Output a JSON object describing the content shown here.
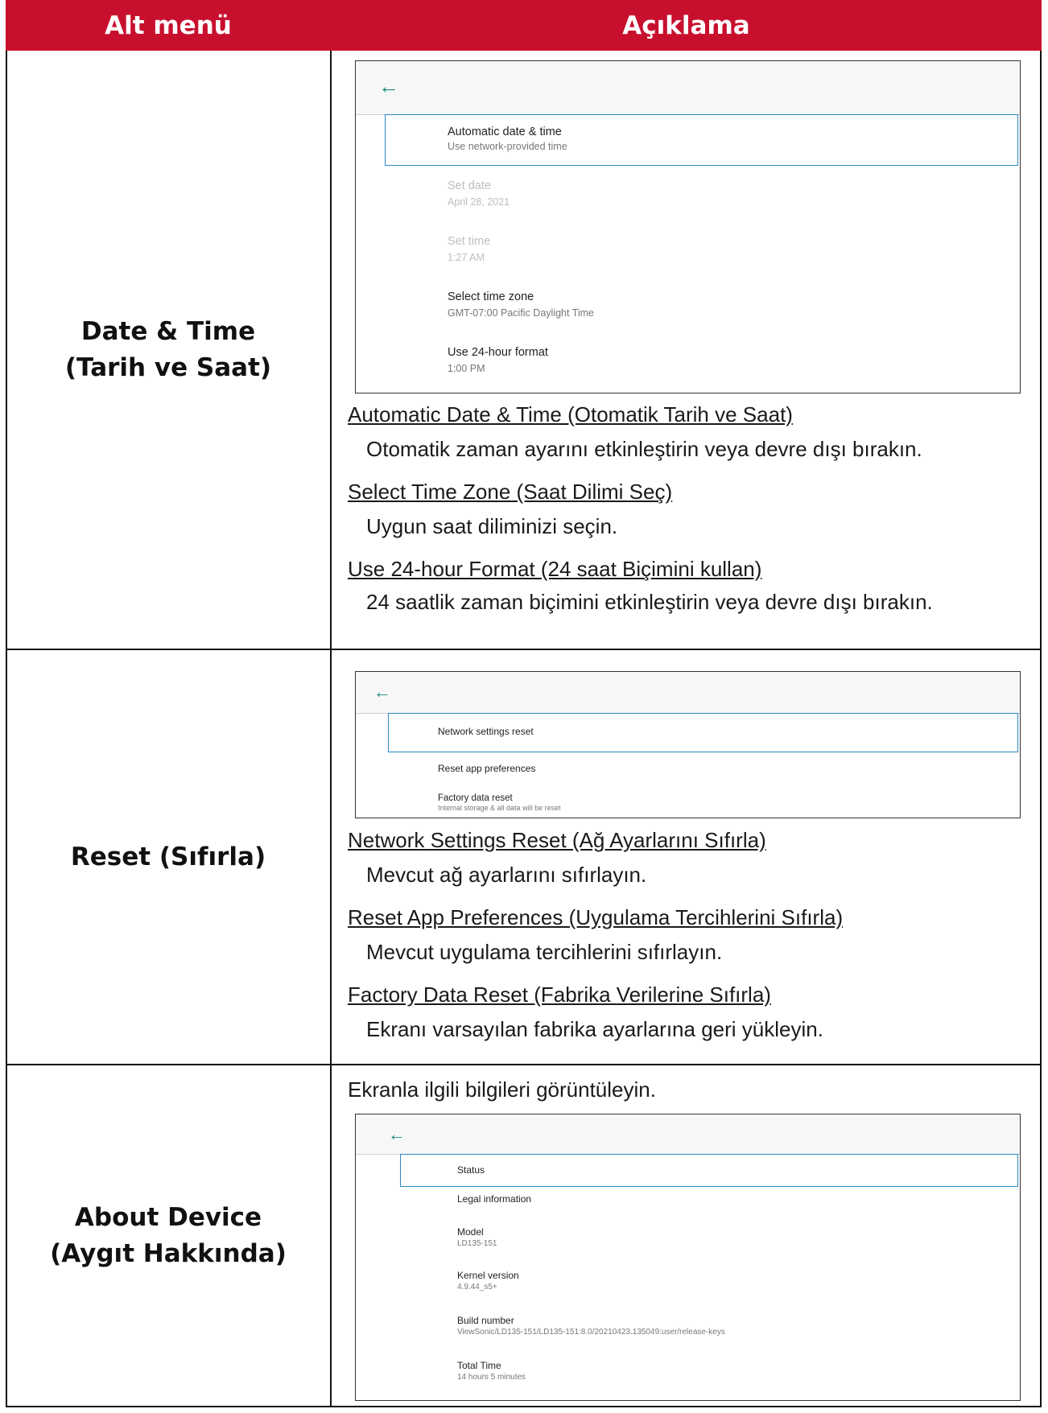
{
  "header": {
    "left": "Alt menü",
    "right": "Açıklama"
  },
  "rows": [
    {
      "title": [
        "Date & Time",
        "(Tarih ve Saat)"
      ],
      "screen": {
        "items": [
          {
            "title": "Automatic date & time",
            "subtitle": "Use network-provided time",
            "dim": false
          },
          {
            "title": "Set date",
            "subtitle": "April 28, 2021",
            "dim": true
          },
          {
            "title": "Set time",
            "subtitle": "1:27 AM",
            "dim": true
          },
          {
            "title": "Select time zone",
            "subtitle": "GMT-07:00 Pacific Daylight Time",
            "dim": false
          },
          {
            "title": "Use 24-hour format",
            "subtitle": "1:00 PM",
            "dim": false
          }
        ]
      },
      "entries": [
        {
          "link": "Automatic Date & Time (Otomatik Tarih ve Saat)",
          "desc": "Otomatik zaman ayarını etkinleştirin veya devre dışı bırakın."
        },
        {
          "link": "Select Time Zone (Saat Dilimi Seç)",
          "desc": "Uygun saat diliminizi seçin."
        },
        {
          "link": "Use 24-hour Format (24 saat Biçimini kullan)",
          "desc": "24 saatlik zaman biçimini etkinleştirin veya devre dışı bırakın."
        }
      ]
    },
    {
      "title": [
        "Reset (Sıfırla)"
      ],
      "screen": {
        "items": [
          {
            "title": "Network settings reset",
            "subtitle": ""
          },
          {
            "title": "Reset app preferences",
            "subtitle": ""
          },
          {
            "title": "Factory data reset",
            "subtitle": "Internal storage & all data will be reset"
          }
        ]
      },
      "entries": [
        {
          "link": "Network Settings Reset (Ağ Ayarlarını Sıfırla)",
          "desc": "Mevcut ağ ayarlarını sıfırlayın."
        },
        {
          "link": "Reset App Preferences (Uygulama Tercihlerini Sıfırla)",
          "desc": "Mevcut uygulama tercihlerini sıfırlayın."
        },
        {
          "link": "Factory Data Reset (Fabrika Verilerine Sıfırla)",
          "desc": "Ekranı varsayılan fabrika ayarlarına geri yükleyin."
        }
      ]
    },
    {
      "title": [
        "About Device",
        "(Aygıt Hakkında)"
      ],
      "intro": "Ekranla ilgili bilgileri görüntüleyin.",
      "screen": {
        "items": [
          {
            "title": "Status",
            "subtitle": ""
          },
          {
            "title": "Legal information",
            "subtitle": ""
          },
          {
            "title": "Model",
            "subtitle": "LD135-151"
          },
          {
            "title": "Kernel version",
            "subtitle": "4.9.44_s5+"
          },
          {
            "title": "Build number",
            "subtitle": "ViewSonic/LD135-151/LD135-151:8.0/20210423.135049:user/release-keys"
          },
          {
            "title": "Total Time",
            "subtitle": "14 hours 5 minutes"
          }
        ]
      }
    }
  ],
  "icons": {
    "back": "arrow-left-icon",
    "accent": "#c8102e",
    "icon_color": "#1b8b7d",
    "focus_color": "#2a88c7"
  }
}
